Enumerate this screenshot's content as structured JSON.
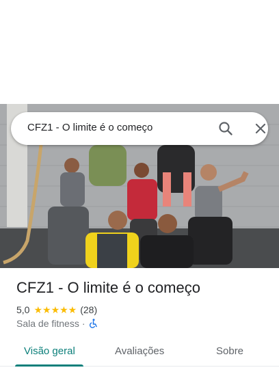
{
  "search": {
    "query": "CFZ1 - O limite é o começo"
  },
  "place": {
    "title": "CFZ1 - O limite é o começo",
    "rating": "5,0",
    "stars": "★★★★★",
    "review_count": "(28)",
    "category": "Sala de fitness",
    "separator": "·"
  },
  "tabs": [
    {
      "label": "Visão geral",
      "active": true
    },
    {
      "label": "Avaliações",
      "active": false
    },
    {
      "label": "Sobre",
      "active": false
    }
  ],
  "colors": {
    "accent": "#0b7f7a",
    "star": "#fbbc04",
    "accessibility": "#1a73e8"
  }
}
